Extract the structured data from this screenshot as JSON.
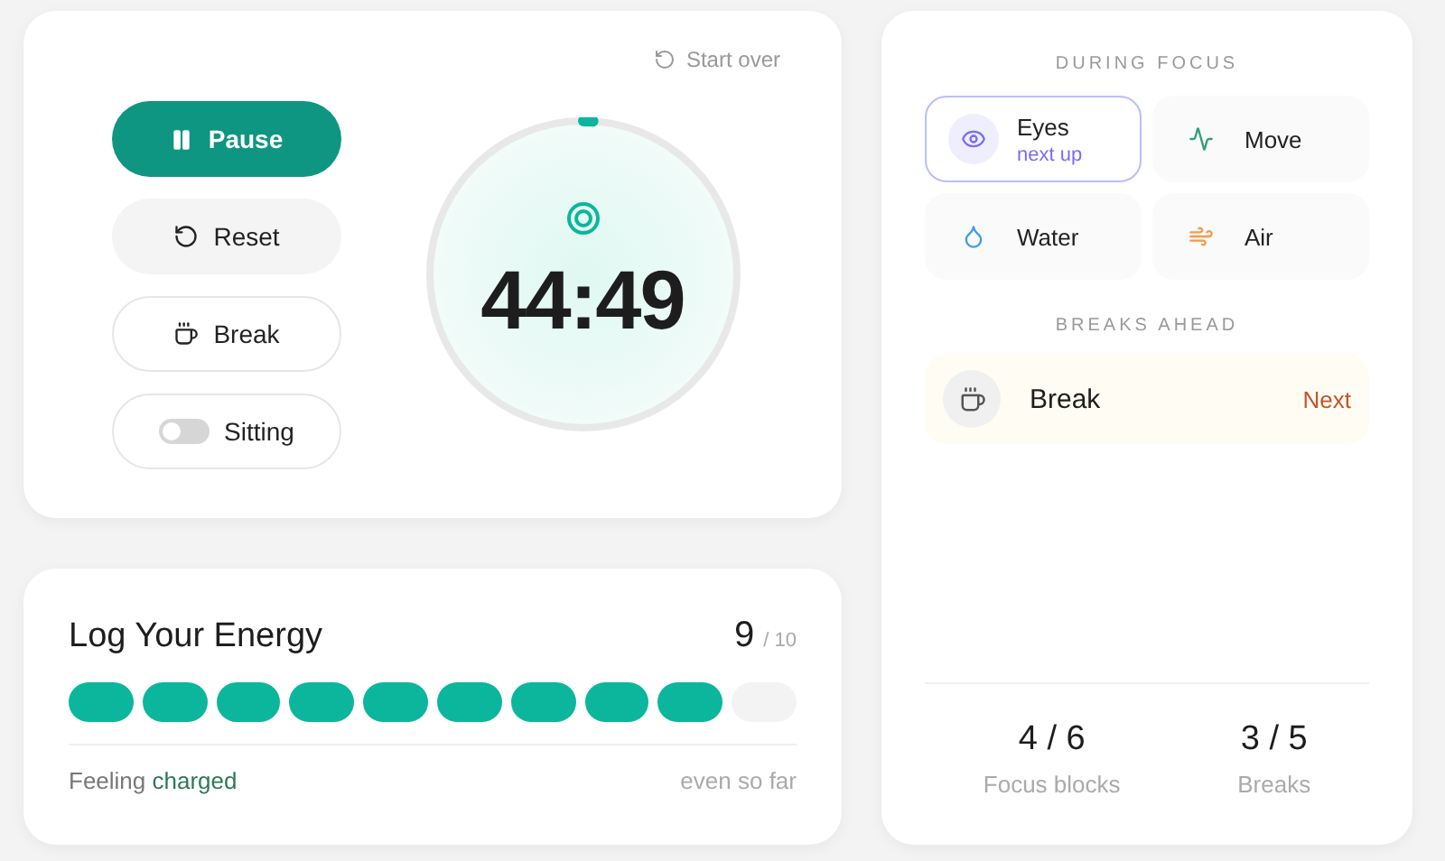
{
  "timer": {
    "start_over": "Start over",
    "time": "44:49",
    "level": 0.01
  },
  "controls": [
    {
      "kind": "pause",
      "label": "Pause"
    },
    {
      "kind": "reset",
      "label": "Reset"
    },
    {
      "kind": "break",
      "label": "Break"
    },
    {
      "kind": "toggle",
      "label": "Sitting",
      "on": false
    }
  ],
  "energy": {
    "title": "Log Your Energy",
    "value": "9",
    "max": "/ 10",
    "feeling": "Feeling **charged**",
    "note": "even so far",
    "segments": [
      {
        "filled": true
      },
      {
        "filled": true
      },
      {
        "filled": true
      },
      {
        "filled": true
      },
      {
        "filled": true
      },
      {
        "filled": true
      },
      {
        "filled": true
      },
      {
        "filled": true
      },
      {
        "filled": true
      },
      {
        "filled": false
      }
    ]
  },
  "during_focus": {
    "heading": "DURING FOCUS",
    "items": [
      {
        "kind": "eye",
        "label": "Eyes",
        "sub": "next up",
        "selected": true,
        "color": "#7b6cf0"
      },
      {
        "kind": "move",
        "label": "Move",
        "selected": false,
        "color": "#2f9e78"
      },
      {
        "kind": "water",
        "label": "Water",
        "selected": false,
        "color": "#3d9be9"
      },
      {
        "kind": "air",
        "label": "Air",
        "selected": false,
        "color": "#f39a4b"
      }
    ]
  },
  "breaks_ahead": {
    "heading": "BREAKS AHEAD",
    "items": [
      {
        "label": "Break",
        "status": "Next"
      }
    ]
  },
  "stats": [
    {
      "value": "4 / 6",
      "label": "Focus blocks"
    },
    {
      "value": "3 / 5",
      "label": "Breaks"
    }
  ]
}
